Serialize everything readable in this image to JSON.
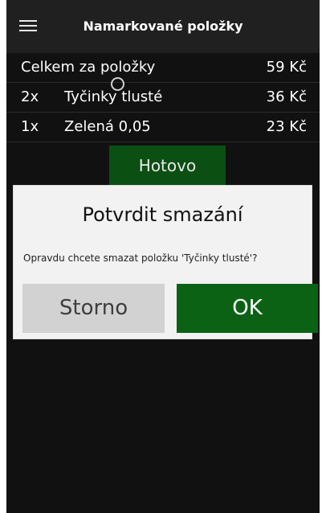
{
  "header": {
    "title": "Namarkované položky",
    "menu_icon": "hamburger-menu-icon"
  },
  "summary": {
    "total_label": "Celkem za položky",
    "total_price": "59 Kč"
  },
  "items": [
    {
      "qty": "2x",
      "name": "Tyčinky tlusté",
      "price": "36 Kč"
    },
    {
      "qty": "1x",
      "name": "Zelená 0,05",
      "price": "23 Kč"
    }
  ],
  "actions": {
    "done_label": "Hotovo"
  },
  "dialog": {
    "title": "Potvrdit smazání",
    "message": "Opravdu chcete smazat položku 'Tyčinky tlusté'?",
    "cancel_label": "Storno",
    "ok_label": "OK"
  },
  "colors": {
    "background": "#111111",
    "appbar": "#202020",
    "primary_green": "#0b6215",
    "dark_green": "#0b4f12",
    "dialog_bg": "#f2f2f2",
    "cancel_bg": "#d2d2d2"
  }
}
